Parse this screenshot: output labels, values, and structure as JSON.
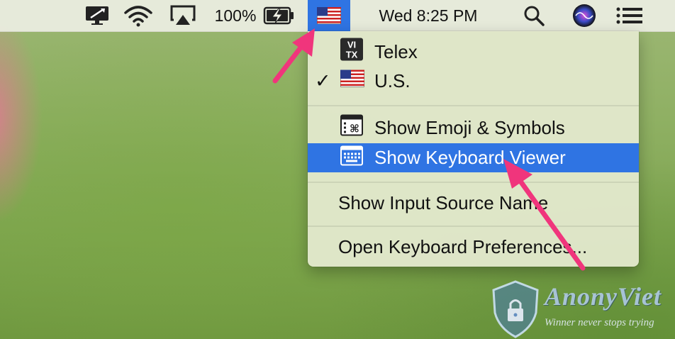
{
  "menubar": {
    "icons": [
      "monitor-sharing-icon",
      "wifi-icon",
      "airplay-icon",
      "battery-charging-icon",
      "us-flag-icon",
      "search-icon",
      "siri-icon",
      "notification-center-icon"
    ],
    "battery_percent": "100%",
    "clock": "Wed 8:25 PM"
  },
  "input_menu": {
    "sources": [
      {
        "label": "Telex",
        "icon": "vitx-icon",
        "checked": false
      },
      {
        "label": "U.S.",
        "icon": "us-flag-icon",
        "checked": true,
        "check_mark": "✓"
      }
    ],
    "actions": [
      {
        "label": "Show Emoji & Symbols",
        "icon": "emoji-symbols-icon",
        "highlighted": false
      },
      {
        "label": "Show Keyboard Viewer",
        "icon": "keyboard-viewer-icon",
        "highlighted": true
      },
      {
        "label": "Show Input Source Name"
      },
      {
        "label": "Open Keyboard Preferences..."
      }
    ],
    "vitx_badge": {
      "line1": "VI",
      "line2": "TX"
    }
  },
  "watermark": {
    "name": "AnonyViet",
    "tagline": "Winner never stops trying"
  },
  "colors": {
    "highlight": "#2f74e3",
    "arrow": "#f0357c",
    "menu_bg": "#e2e8cc"
  }
}
